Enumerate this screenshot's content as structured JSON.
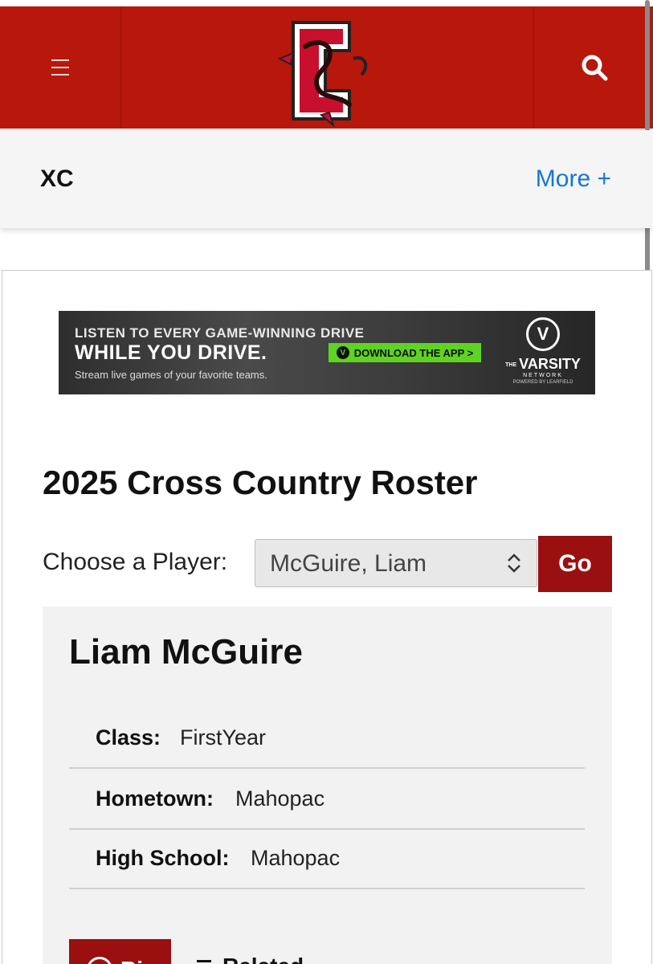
{
  "header": {
    "menu_icon": "hamburger-icon",
    "logo_icon": "dragon-c-logo",
    "search_icon": "search-icon",
    "brand_color": "#b8170b"
  },
  "sportbar": {
    "sport": "XC",
    "more_label": "More +"
  },
  "ad": {
    "line1": "LISTEN TO EVERY GAME-WINNING DRIVE",
    "line2": "WHILE YOU DRIVE.",
    "line3": "Stream live games of your favorite teams.",
    "button_label": "DOWNLOAD THE APP >",
    "brand_name": "VARSITY",
    "brand_prefix": "THE",
    "brand_sub": "NETWORK",
    "brand_powered": "POWERED BY LEARFIELD"
  },
  "roster": {
    "title": "2025 Cross Country Roster",
    "choose_label": "Choose a Player:",
    "selected_player": "McGuire, Liam",
    "go_label": "Go"
  },
  "player": {
    "name": "Liam McGuire",
    "fields": [
      {
        "label": "Class:",
        "value": "FirstYear"
      },
      {
        "label": "Hometown:",
        "value": "Mahopac"
      },
      {
        "label": "High School:",
        "value": "Mahopac"
      }
    ],
    "bio_label": "Bio",
    "related_label": "Related"
  }
}
